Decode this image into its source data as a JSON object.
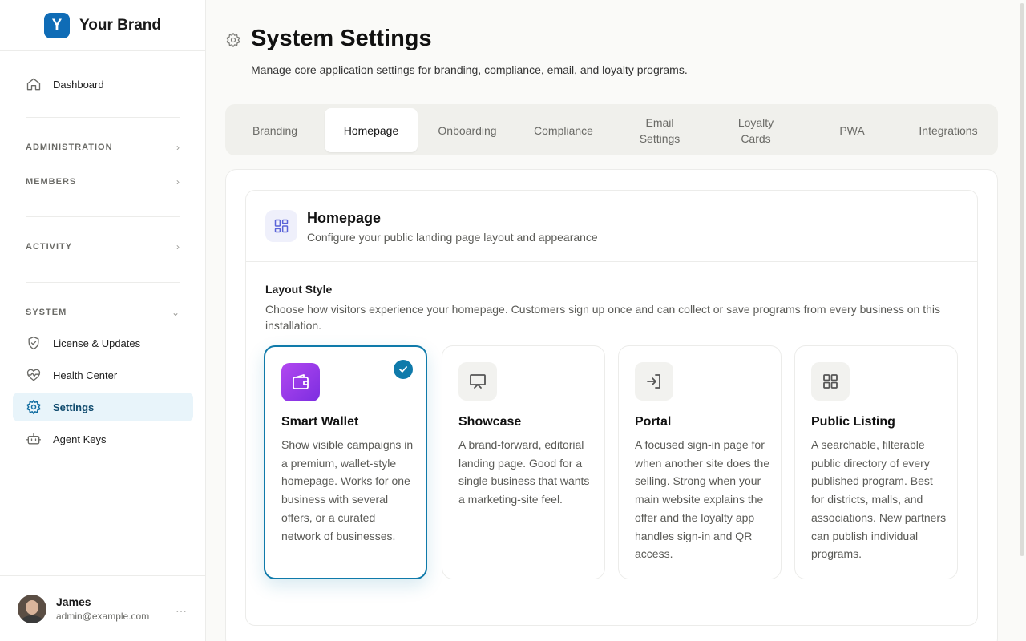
{
  "brand": {
    "logo_letter": "Y",
    "name": "Your Brand",
    "color": "#0f6cb6"
  },
  "sidebar": {
    "dashboard": "Dashboard",
    "sections": {
      "administration": "ADMINISTRATION",
      "members": "MEMBERS",
      "activity": "ACTIVITY",
      "system": "SYSTEM"
    },
    "system_items": {
      "license": "License & Updates",
      "health": "Health Center",
      "settings": "Settings",
      "agent_keys": "Agent Keys"
    },
    "active_item": "Settings"
  },
  "user": {
    "name": "James",
    "email": "admin@example.com",
    "more": "⋯"
  },
  "page": {
    "title": "System Settings",
    "subtitle": "Manage core application settings for branding, compliance, email, and loyalty programs."
  },
  "tabs": {
    "branding": "Branding",
    "homepage": "Homepage",
    "onboarding": "Onboarding",
    "compliance": "Compliance",
    "email_1": "Email",
    "email_2": "Settings",
    "loyalty_1": "Loyalty",
    "loyalty_2": "Cards",
    "pwa": "PWA",
    "integrations": "Integrations",
    "active": "Homepage"
  },
  "section": {
    "title": "Homepage",
    "description": "Configure your public landing page layout and appearance",
    "layout_label": "Layout Style",
    "layout_description": "Choose how visitors experience your homepage. Customers sign up once and can collect or save programs from every business on this installation."
  },
  "options": {
    "smart_wallet": {
      "title": "Smart Wallet",
      "description": "Show visible campaigns in a premium, wallet-style homepage. Works for one business with several offers, or a curated network of businesses.",
      "selected": true
    },
    "showcase": {
      "title": "Showcase",
      "description": "A brand-forward, editorial landing page. Good for a single business that wants a marketing-site feel."
    },
    "portal": {
      "title": "Portal",
      "description": "A focused sign-in page for when another site does the selling. Strong when your main website explains the offer and the loyalty app handles sign-in and QR access."
    },
    "public_listing": {
      "title": "Public Listing",
      "description": "A searchable, filterable public directory of every published program. Best for districts, malls, and associations. New partners can publish individual programs."
    }
  },
  "colors": {
    "accent": "#0f7aaa",
    "active_nav_bg": "#e8f4fa",
    "smart_wallet_icon": "#9b3cea"
  }
}
